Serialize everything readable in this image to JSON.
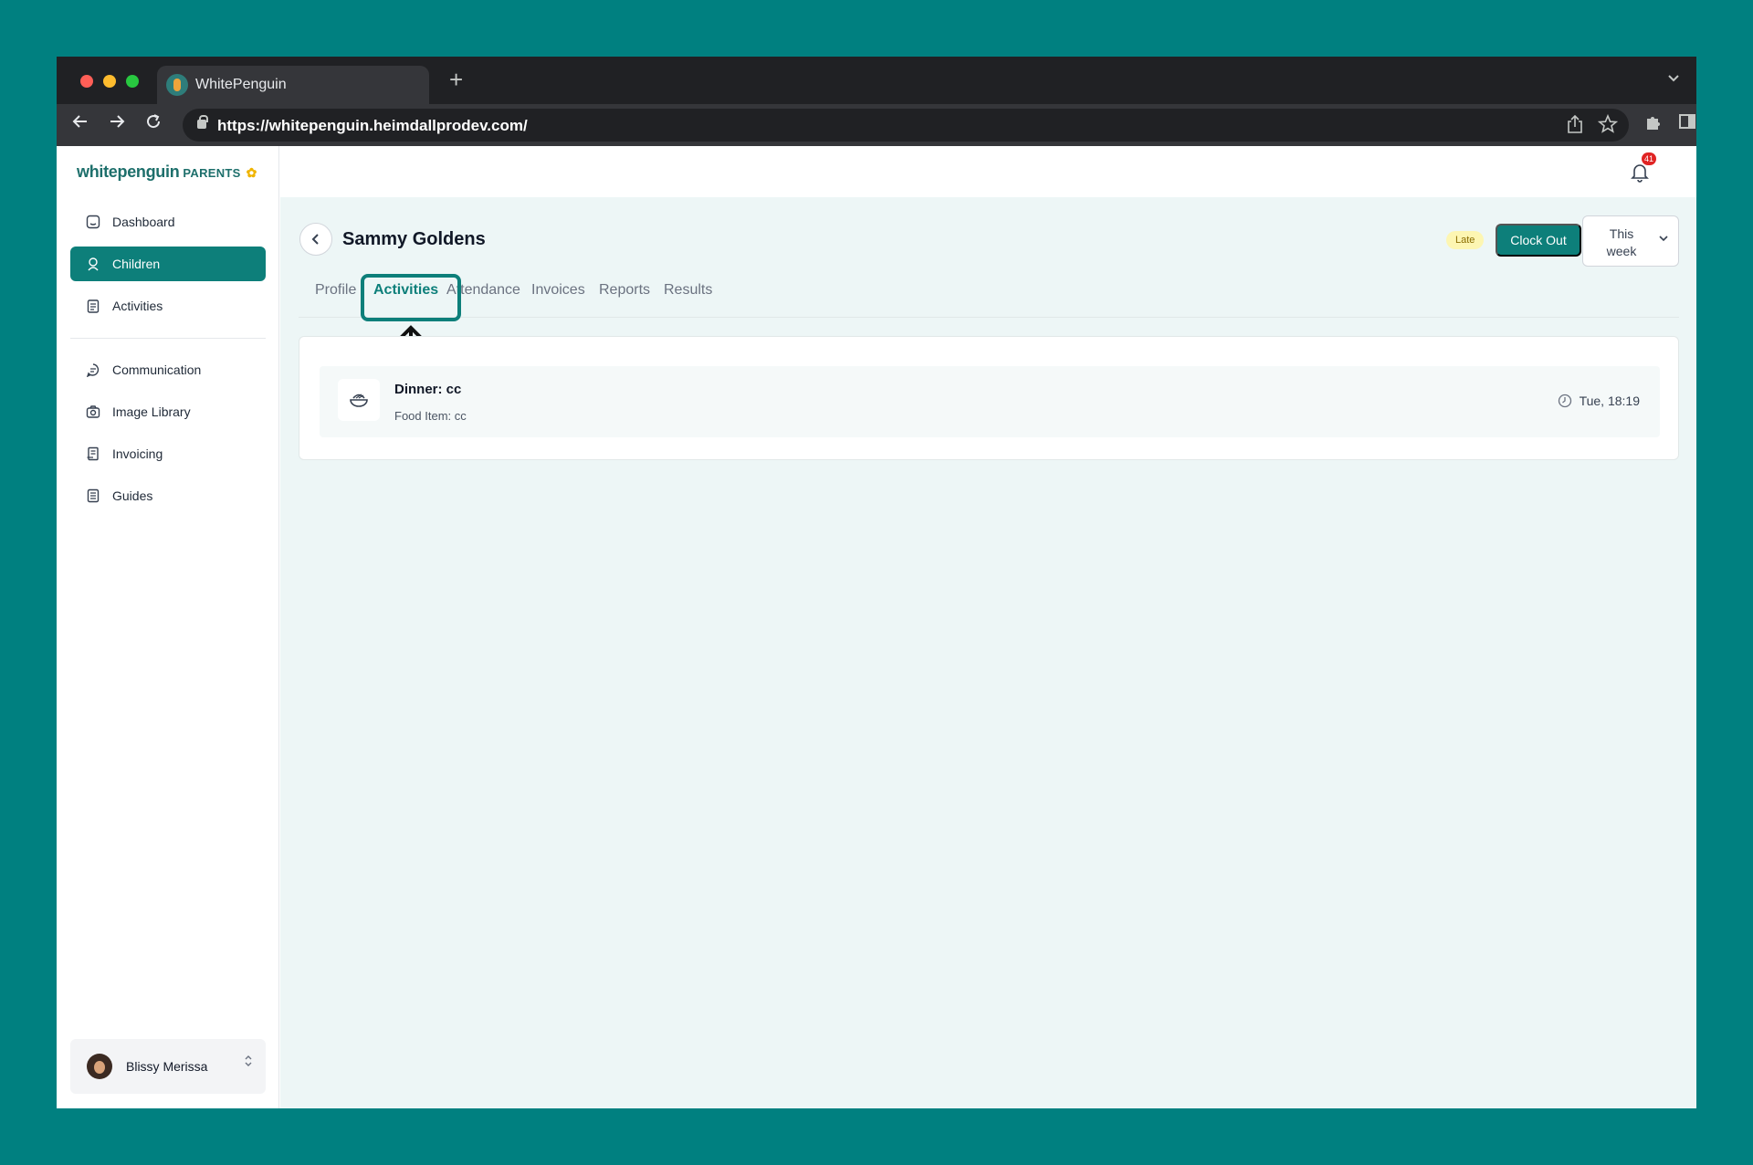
{
  "browser": {
    "tab_title": "WhitePenguin",
    "new_tab_glyph": "+",
    "url": "https://whitepenguin.heimdallprodev.com/"
  },
  "app": {
    "logo_text": "whitepenguin",
    "logo_badge": "PARENTS",
    "accent_color": "#0d7f7a"
  },
  "sidebar": {
    "items": [
      {
        "label": "Dashboard",
        "icon": "dashboard-icon"
      },
      {
        "label": "Children",
        "icon": "children-icon",
        "active": true
      },
      {
        "label": "Activities",
        "icon": "activities-icon"
      },
      {
        "label": "Communication",
        "icon": "chat-icon"
      },
      {
        "label": "Image Library",
        "icon": "camera-icon"
      },
      {
        "label": "Invoicing",
        "icon": "invoice-icon"
      },
      {
        "label": "Guides",
        "icon": "guide-icon"
      }
    ],
    "user_name": "Blissy Merissa"
  },
  "header": {
    "notification_count": "41"
  },
  "child": {
    "name": "Sammy Goldens",
    "status_badge": "Late",
    "clock_out_label": "Clock Out",
    "range_line1": "This",
    "range_line2": "week"
  },
  "tabs": [
    {
      "label": "Profile"
    },
    {
      "label": "Activities",
      "active": true
    },
    {
      "label": "Attendance"
    },
    {
      "label": "Invoices"
    },
    {
      "label": "Reports"
    },
    {
      "label": "Results"
    }
  ],
  "activities": [
    {
      "title": "Dinner: cc",
      "subtitle": "Food Item: cc",
      "time": "Tue, 18:19"
    }
  ]
}
